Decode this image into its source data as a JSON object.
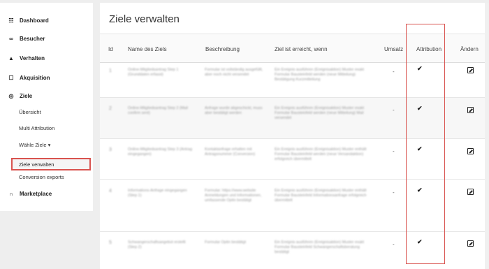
{
  "sidebar": {
    "items": [
      {
        "label": "Dashboard",
        "icon": "dashboard-icon"
      },
      {
        "label": "Besucher",
        "icon": "binoculars-icon"
      },
      {
        "label": "Verhalten",
        "icon": "bell-icon"
      },
      {
        "label": "Akquisition",
        "icon": "square-icon"
      },
      {
        "label": "Ziele",
        "icon": "target-icon"
      }
    ],
    "sub_items": [
      "Übersicht",
      "Multi Attribution",
      "Wähle Ziele ▾",
      "Ziele verwalten",
      "Conversion exports"
    ],
    "marketplace": {
      "label": "Marketplace",
      "icon": "marketplace-icon"
    }
  },
  "main": {
    "title": "Ziele verwalten",
    "columns": [
      "Id",
      "Name des Ziels",
      "Beschreibung",
      "Ziel ist erreicht, wenn",
      "Umsatz",
      "Attribution",
      "Ändern"
    ]
  },
  "rows": [
    {
      "id": "1",
      "name": "Online-Mitgliedsantrag Step 1 (Grunddaten erfasst)",
      "description": "Formular ist vollständig ausgefüllt, aber noch nicht versendet",
      "condition": "Ein Ereignis ausführen (Ereignisaktion) Muster exakt Formular Bausteinfeld werden (neue Mitteilung) Bestätigung Kurzmitteilung",
      "umsatz": "-",
      "attribution": "✔"
    },
    {
      "id": "2",
      "name": "Online-Mitgliedsantrag Step 2 (Mail confirm sent)",
      "description": "Anfrage wurde abgeschickt, muss aber bestätigt werden",
      "condition": "Ein Ereignis ausführen (Ereignisaktion) Muster exakt Formular Bausteinfeld werden (neue Mitteilung) Mail versendet",
      "umsatz": "-",
      "attribution": "✔"
    },
    {
      "id": "3",
      "name": "Online-Mitgliedsantrag Step 3 (Antrag eingegangen)",
      "description": "Kontaktanfrage erhalten mit Antragsnummer (Conversion)",
      "condition": "Ein Ereignis ausführen (Ereignisaktion) Muster enthält Formular Bausteinfeld werden (neue Versandaktion) erfolgreich übermittelt",
      "umsatz": "-",
      "attribution": "✔"
    },
    {
      "id": "4",
      "name": "Informations-Anfrage eingegangen (Step 1)",
      "description": "Formular: https://www.website Anmeldungen und Informationen, umfassende Optin bestätigt",
      "condition": "Ein Ereignis ausführen (Ereignisaktion) Muster enthält Formular Bausteinfeld Informationsanfrage erfolgreich übermittelt",
      "umsatz": "-",
      "attribution": "✔"
    },
    {
      "id": "5",
      "name": "Schwangerschaftsangebot erstellt (Step 2)",
      "description": "Formular Optin bestätigt",
      "condition": "Ein Ereignis ausführen (Ereignisaktion) Muster exakt Formular Bausteinfeld Schwangerschaftsberatung bestätigt",
      "umsatz": "-",
      "attribution": "✔"
    }
  ]
}
